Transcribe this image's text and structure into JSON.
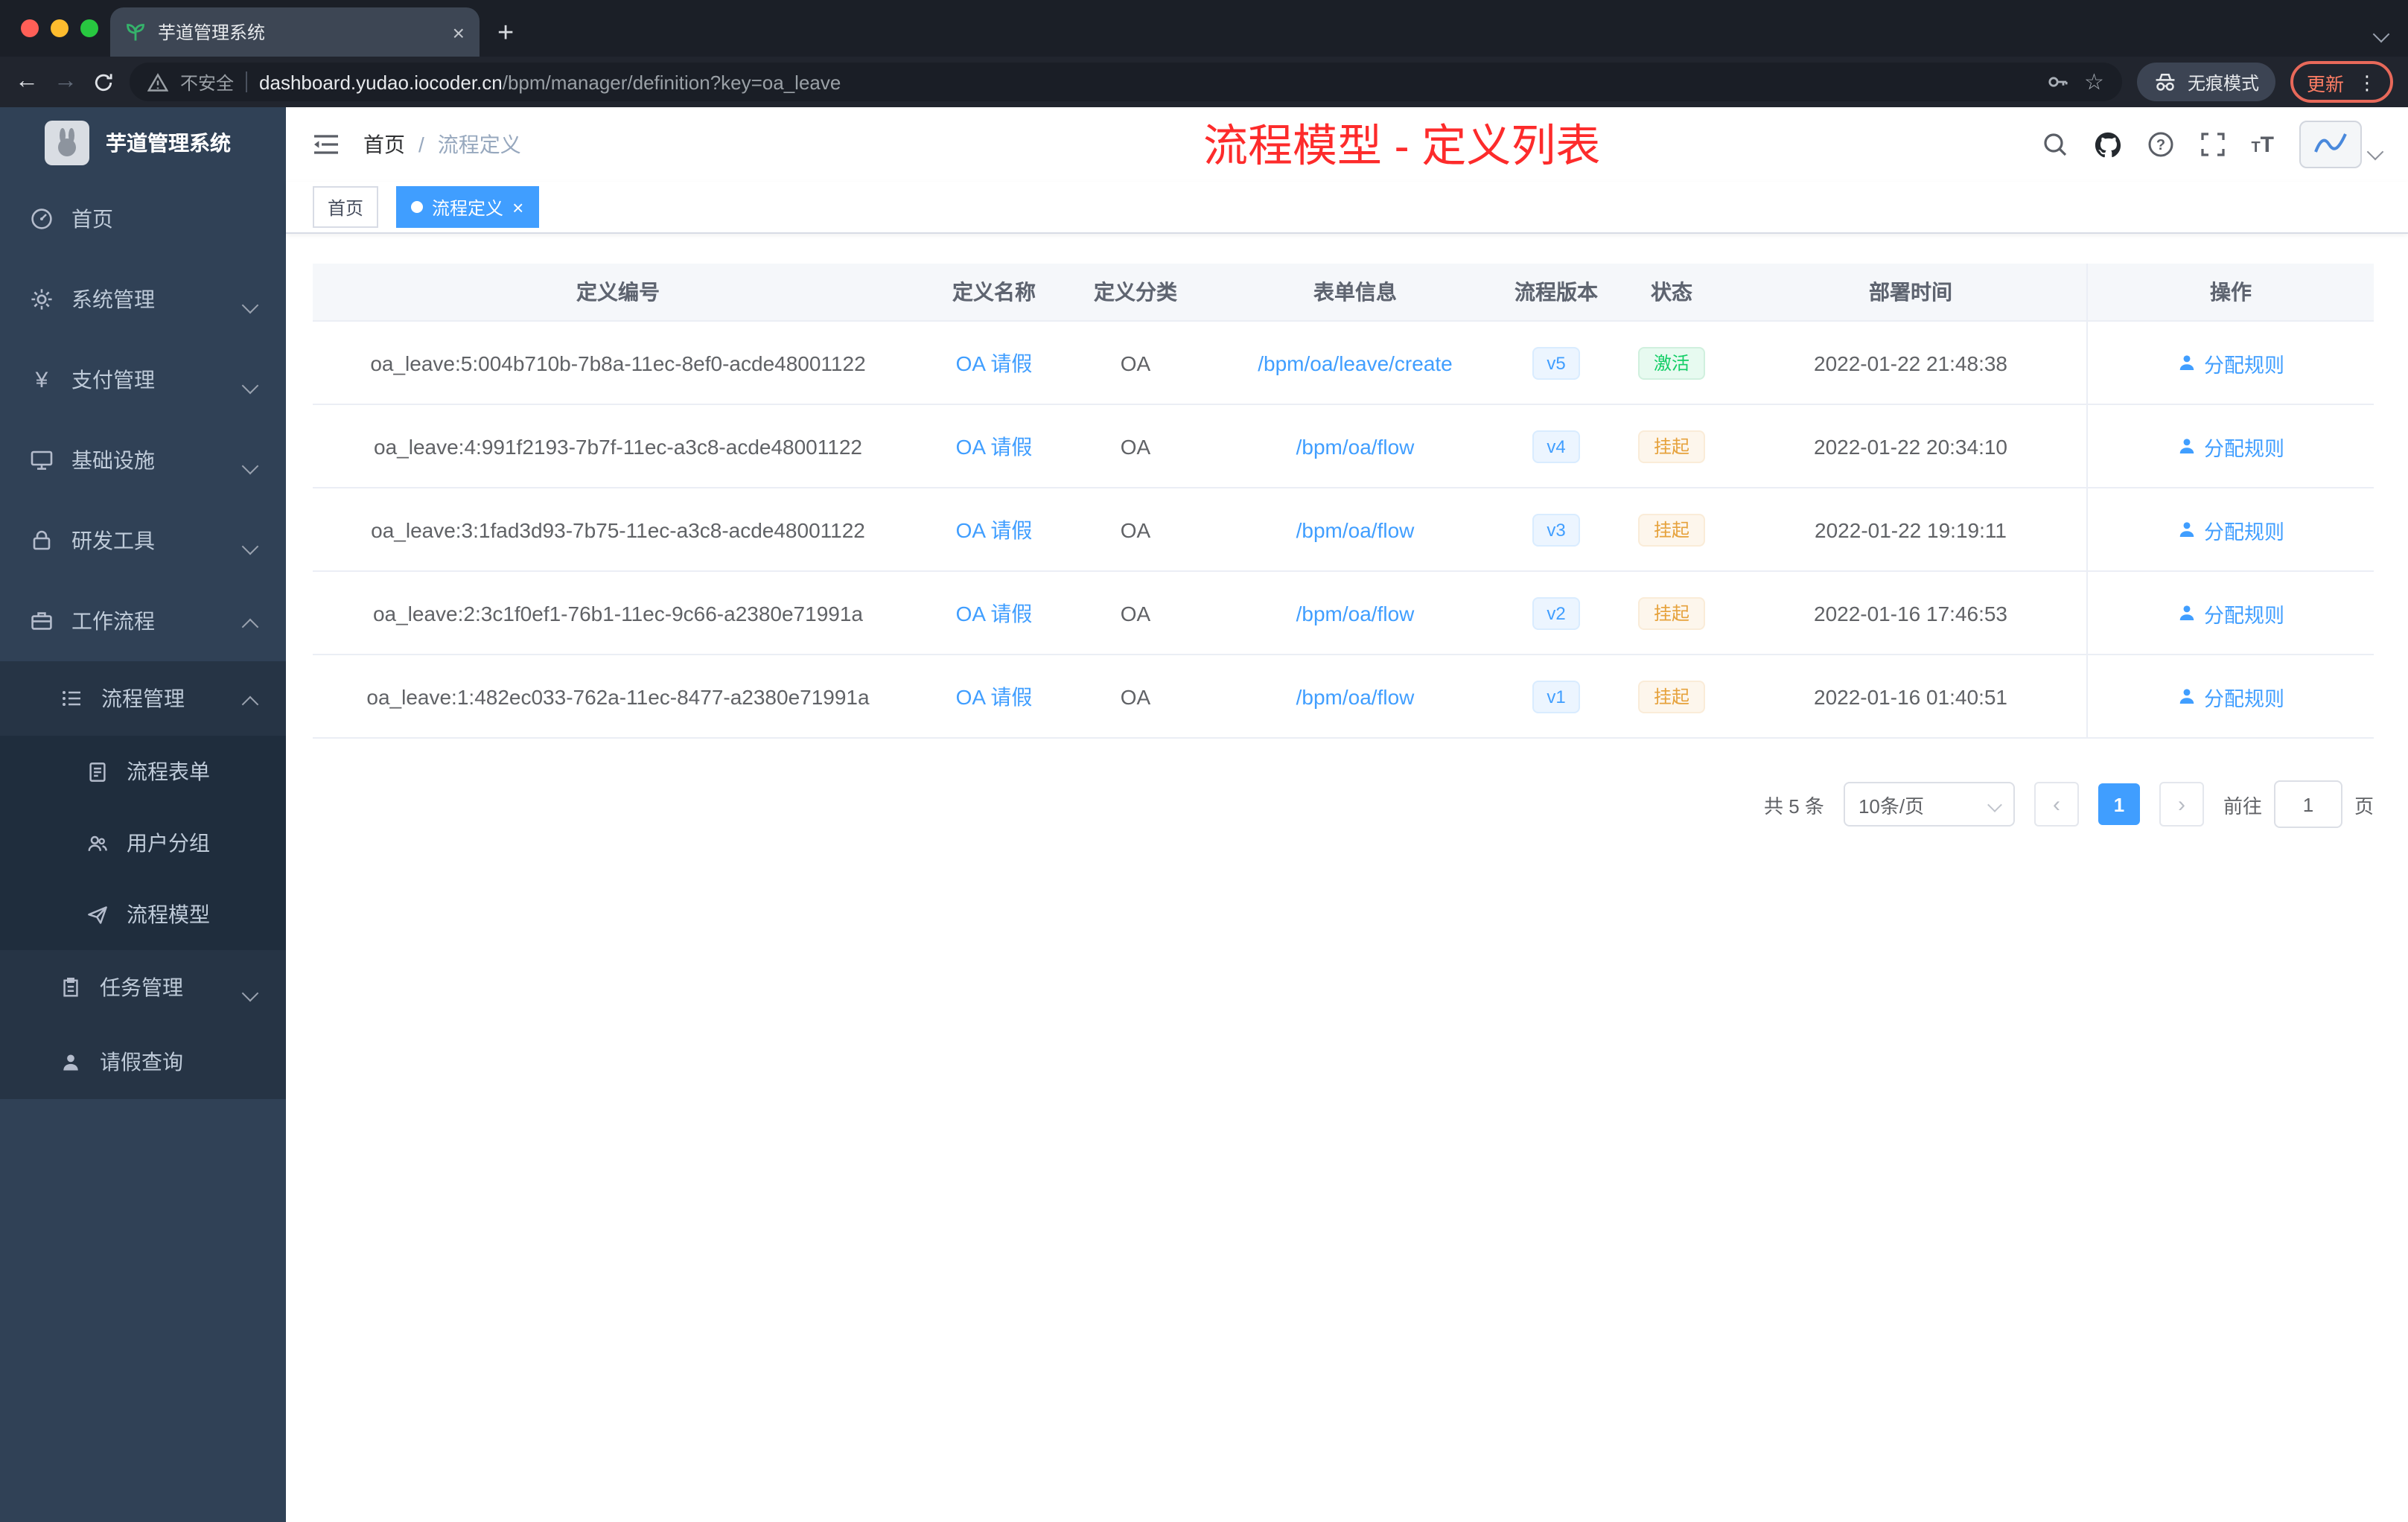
{
  "colors": {
    "accent": "#409eff",
    "success": "#13ce66",
    "warning": "#e6a23c",
    "annotation_red": "#fd2b2b",
    "sidebar_bg": "#304156"
  },
  "browser": {
    "tab_title": "芋道管理系统",
    "security_label": "不安全",
    "url_domain": "dashboard.yudao.iocoder.cn",
    "url_path": "/bpm/manager/definition?key=oa_leave",
    "incognito_label": "无痕模式",
    "update_label": "更新"
  },
  "sidebar": {
    "logo_title": "芋道管理系统",
    "items": [
      {
        "label": "首页"
      },
      {
        "label": "系统管理"
      },
      {
        "label": "支付管理"
      },
      {
        "label": "基础设施"
      },
      {
        "label": "研发工具"
      },
      {
        "label": "工作流程"
      },
      {
        "label": "流程管理"
      },
      {
        "label": "流程表单"
      },
      {
        "label": "用户分组"
      },
      {
        "label": "流程模型"
      },
      {
        "label": "任务管理"
      },
      {
        "label": "请假查询"
      }
    ]
  },
  "header": {
    "breadcrumb_home": "首页",
    "breadcrumb_sep": "/",
    "breadcrumb_current": "流程定义",
    "annotation": "流程模型 - 定义列表"
  },
  "tags": {
    "home": "首页",
    "active": "流程定义"
  },
  "table": {
    "columns": [
      "定义编号",
      "定义名称",
      "定义分类",
      "表单信息",
      "流程版本",
      "状态",
      "部署时间",
      "操作"
    ],
    "rows": [
      {
        "id": "oa_leave:5:004b710b-7b8a-11ec-8ef0-acde48001122",
        "name": "OA 请假",
        "category": "OA",
        "form": "/bpm/oa/leave/create",
        "version": "v5",
        "status": "激活",
        "deploy_time": "2022-01-22 21:48:38",
        "action": "分配规则"
      },
      {
        "id": "oa_leave:4:991f2193-7b7f-11ec-a3c8-acde48001122",
        "name": "OA 请假",
        "category": "OA",
        "form": "/bpm/oa/flow",
        "version": "v4",
        "status": "挂起",
        "deploy_time": "2022-01-22 20:34:10",
        "action": "分配规则"
      },
      {
        "id": "oa_leave:3:1fad3d93-7b75-11ec-a3c8-acde48001122",
        "name": "OA 请假",
        "category": "OA",
        "form": "/bpm/oa/flow",
        "version": "v3",
        "status": "挂起",
        "deploy_time": "2022-01-22 19:19:11",
        "action": "分配规则"
      },
      {
        "id": "oa_leave:2:3c1f0ef1-76b1-11ec-9c66-a2380e71991a",
        "name": "OA 请假",
        "category": "OA",
        "form": "/bpm/oa/flow",
        "version": "v2",
        "status": "挂起",
        "deploy_time": "2022-01-16 17:46:53",
        "action": "分配规则"
      },
      {
        "id": "oa_leave:1:482ec033-762a-11ec-8477-a2380e71991a",
        "name": "OA 请假",
        "category": "OA",
        "form": "/bpm/oa/flow",
        "version": "v1",
        "status": "挂起",
        "deploy_time": "2022-01-16 01:40:51",
        "action": "分配规则"
      }
    ]
  },
  "pagination": {
    "total": "共 5 条",
    "page_size": "10条/页",
    "page": "1",
    "goto_label": "前往",
    "goto_value": "1",
    "goto_unit": "页"
  },
  "icons": {
    "close": "×",
    "plus": "+",
    "back": "←",
    "forward": "→",
    "star": "☆",
    "kebab": "⋮",
    "prev": "‹",
    "next": "›",
    "question": "?",
    "font_big": "T",
    "font_small": "T"
  }
}
